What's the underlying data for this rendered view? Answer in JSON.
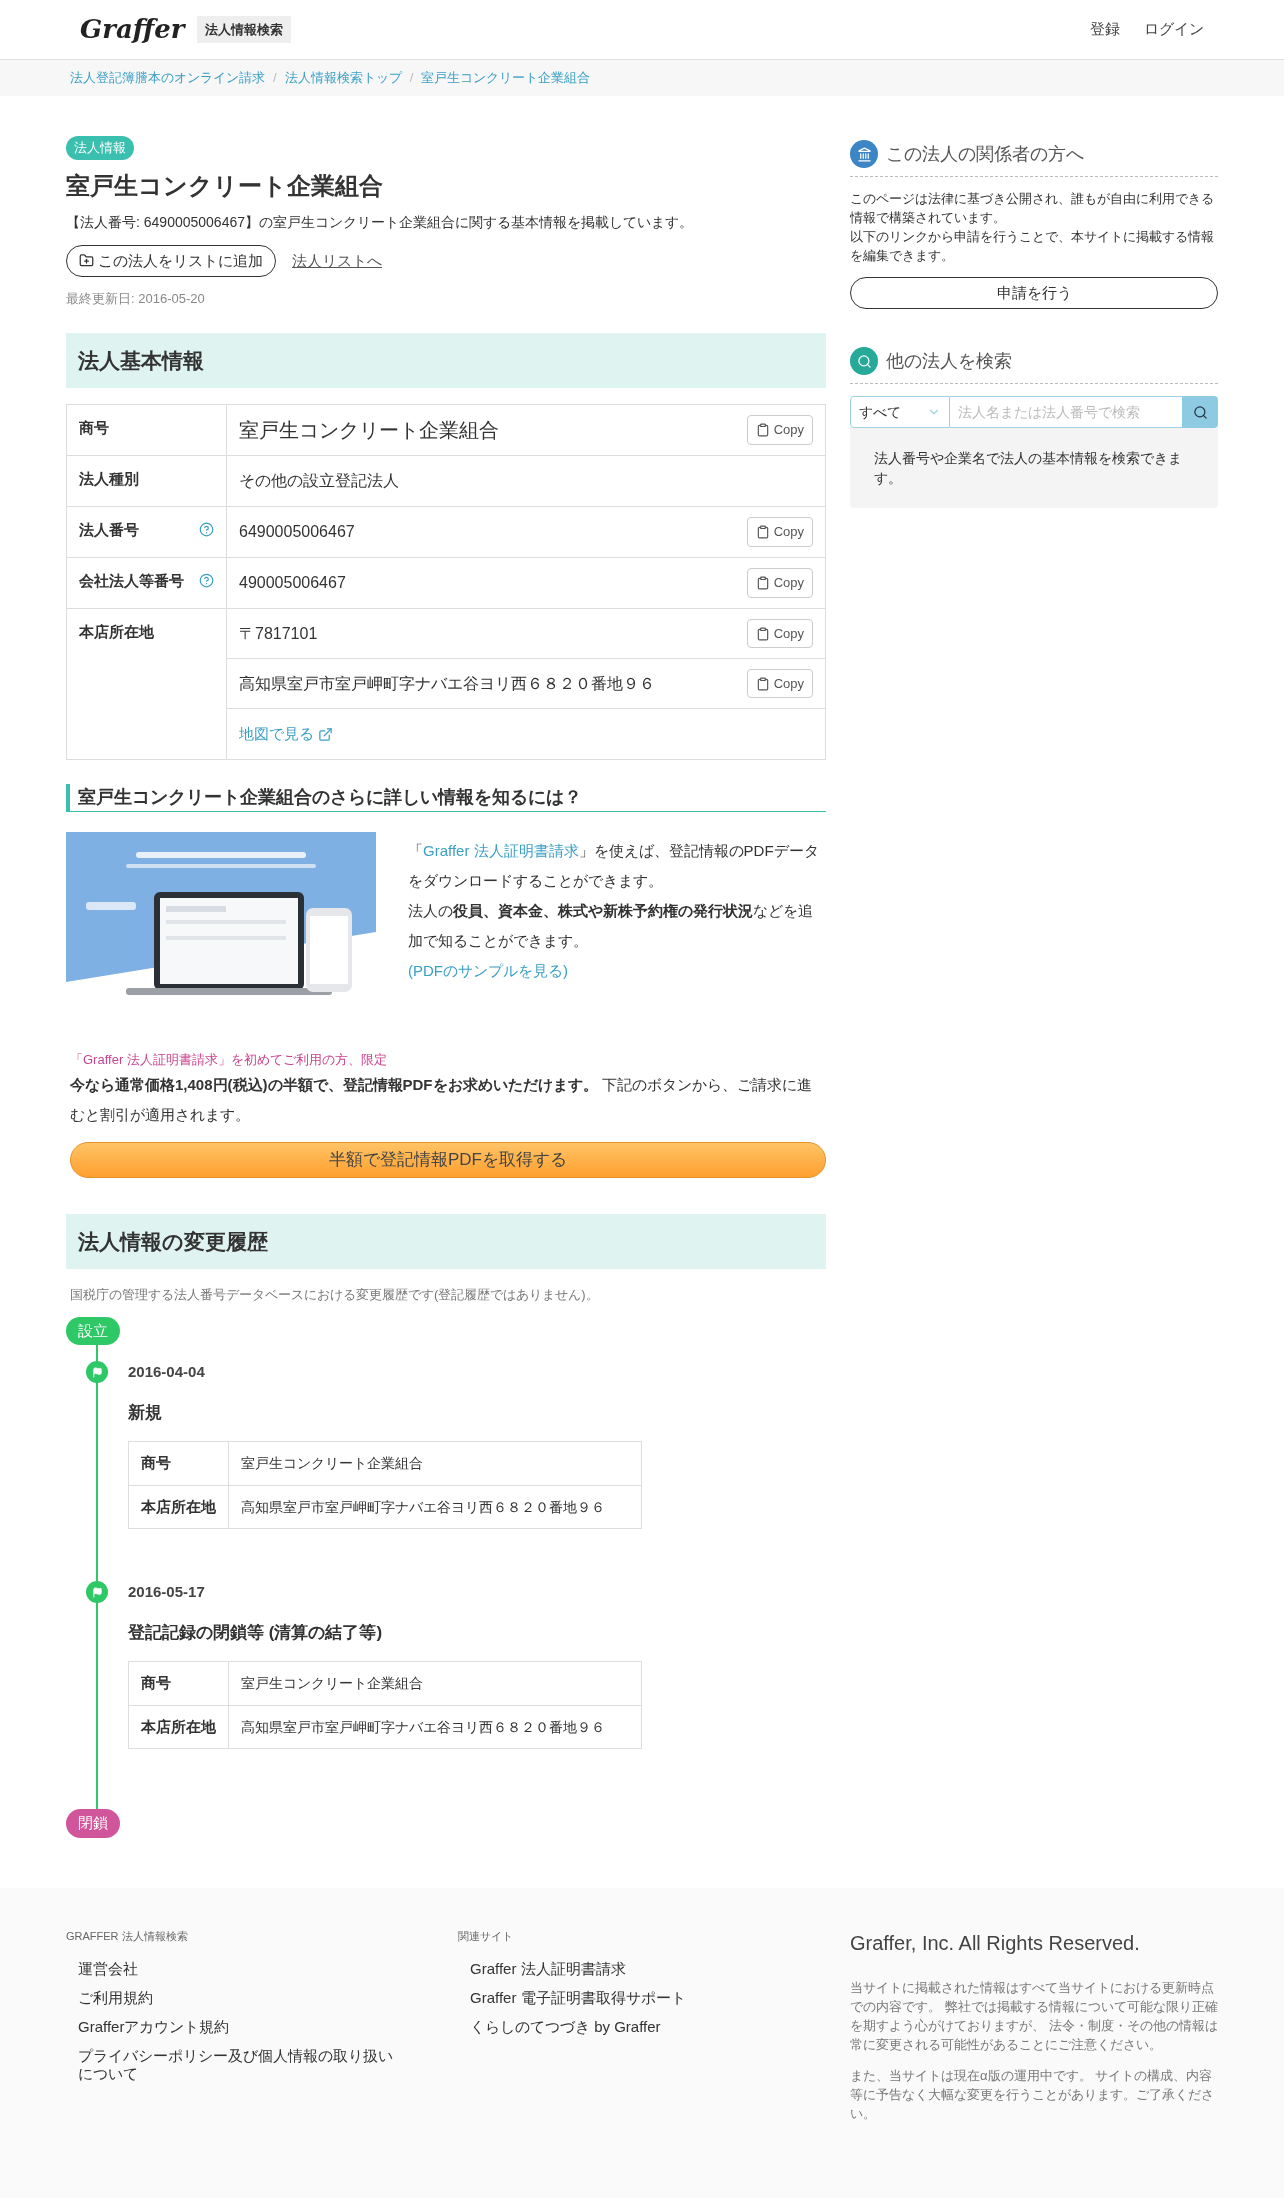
{
  "header": {
    "logo": "Graffer",
    "service": "法人情報検索",
    "nav": [
      "登録",
      "ログイン"
    ]
  },
  "breadcrumbs": {
    "separator": "/",
    "items": [
      "法人登記簿謄本のオンライン請求",
      "法人情報検索トップ",
      "室戸生コンクリート企業組合"
    ]
  },
  "corp": {
    "badge": "法人情報",
    "name": "室戸生コンクリート企業組合",
    "description": "【法人番号: 6490005006467】の室戸生コンクリート企業組合に関する基本情報を掲載しています。",
    "add_button": "この法人をリストに追加",
    "list_link": "法人リストへ",
    "updated": "最終更新日: 2016-05-20"
  },
  "basic_info": {
    "heading": "法人基本情報",
    "rows": [
      {
        "label": "商号",
        "help": false,
        "values": [
          {
            "kind": "large",
            "text": "室戸生コンクリート企業組合",
            "copy": "Copy"
          }
        ]
      },
      {
        "label": "法人種別",
        "help": false,
        "values": [
          {
            "kind": "plain",
            "text": "その他の設立登記法人"
          }
        ]
      },
      {
        "label": "法人番号",
        "help": true,
        "values": [
          {
            "kind": "plain",
            "text": "6490005006467",
            "copy": "Copy"
          }
        ]
      },
      {
        "label": "会社法人等番号",
        "help": true,
        "values": [
          {
            "kind": "plain",
            "text": "490005006467",
            "copy": "Copy"
          }
        ]
      },
      {
        "label": "本店所在地",
        "help": false,
        "values": [
          {
            "kind": "plain",
            "text": "〒7817101",
            "copy": "Copy"
          },
          {
            "kind": "plain",
            "text": "高知県室戸市室戸岬町字ナバエ谷ヨリ西６８２０番地９６",
            "copy": "Copy"
          },
          {
            "kind": "link",
            "text": "地図で見る"
          }
        ]
      }
    ]
  },
  "promo": {
    "heading": "室戸生コンクリート企業組合のさらに詳しい情報を知るには？",
    "open_quote": "「",
    "service_link": "Graffer 法人証明書請求",
    "after_link": "」を使えば、登記情報のPDFデータをダウンロードすることができます。",
    "detail": "法人の**役員、資本金、株式や新株予約権の発行状況**などを追加で知ることができます。",
    "sample_link": "(PDFのサンプルを見る)",
    "first_time": "「Graffer 法人証明書請求」を初めてご利用の方、限定",
    "offer": "**今なら通常価格1,408円(税込)の半額で、登記情報PDFをお求めいただけます。** 下記のボタンから、ご請求に進むと割引が適用されます。",
    "button": "半額で登記情報PDFを取得する"
  },
  "history": {
    "heading": "法人情報の変更履歴",
    "note": "国税庁の管理する法人番号データベースにおける変更履歴です(登記履歴ではありません)。",
    "start": {
      "label": "設立",
      "color": "#2ec866"
    },
    "events": [
      {
        "date": "2016-04-04",
        "title": "新規",
        "rows": [
          {
            "label": "商号",
            "value": "室戸生コンクリート企業組合"
          },
          {
            "label": "本店所在地",
            "value": "高知県室戸市室戸岬町字ナバエ谷ヨリ西６８２０番地９６"
          }
        ]
      },
      {
        "date": "2016-05-17",
        "title": "登記記録の閉鎖等 (清算の結了等)",
        "rows": [
          {
            "label": "商号",
            "value": "室戸生コンクリート企業組合"
          },
          {
            "label": "本店所在地",
            "value": "高知県室戸市室戸岬町字ナバエ谷ヨリ西６８２０番地９６"
          }
        ]
      }
    ],
    "end": {
      "label": "閉鎖",
      "color": "#d0559a"
    }
  },
  "sidebar": {
    "related": {
      "heading": "この法人の関係者の方へ",
      "text": [
        "このページは法律に基づき公開され、誰もが自由に利用できる情報で構築されています。",
        "以下のリンクから申請を行うことで、本サイトに掲載する情報を編集できます。"
      ],
      "button": "申請を行う"
    },
    "search": {
      "heading": "他の法人を検索",
      "select": "すべて",
      "placeholder": "法人名または法人番号で検索",
      "help": "法人番号や企業名で法人の基本情報を検索できます。"
    }
  },
  "footer": {
    "columns": [
      {
        "heading": "GRAFFER 法人情報検索",
        "links": [
          "運営会社",
          "ご利用規約",
          "Grafferアカウント規約",
          "プライバシーポリシー及び個人情報の取り扱いについて"
        ]
      },
      {
        "heading": "関連サイト",
        "links": [
          "Graffer 法人証明書請求",
          "Graffer 電子証明書取得サポート",
          "くらしのてつづき by Graffer"
        ]
      }
    ],
    "copyright": "Graffer, Inc. All Rights Reserved.",
    "notes": [
      "当サイトに掲載された情報はすべて当サイトにおける更新時点での内容です。 弊社では掲載する情報について可能な限り正確を期すよう心がけておりますが、 法令・制度・その他の情報は常に変更される可能性があることにご注意ください。",
      "また、当サイトは現在α版の運用中です。 サイトの構成、内容等に予告なく大幅な変更を行うことがあります。ご了承ください。"
    ]
  }
}
